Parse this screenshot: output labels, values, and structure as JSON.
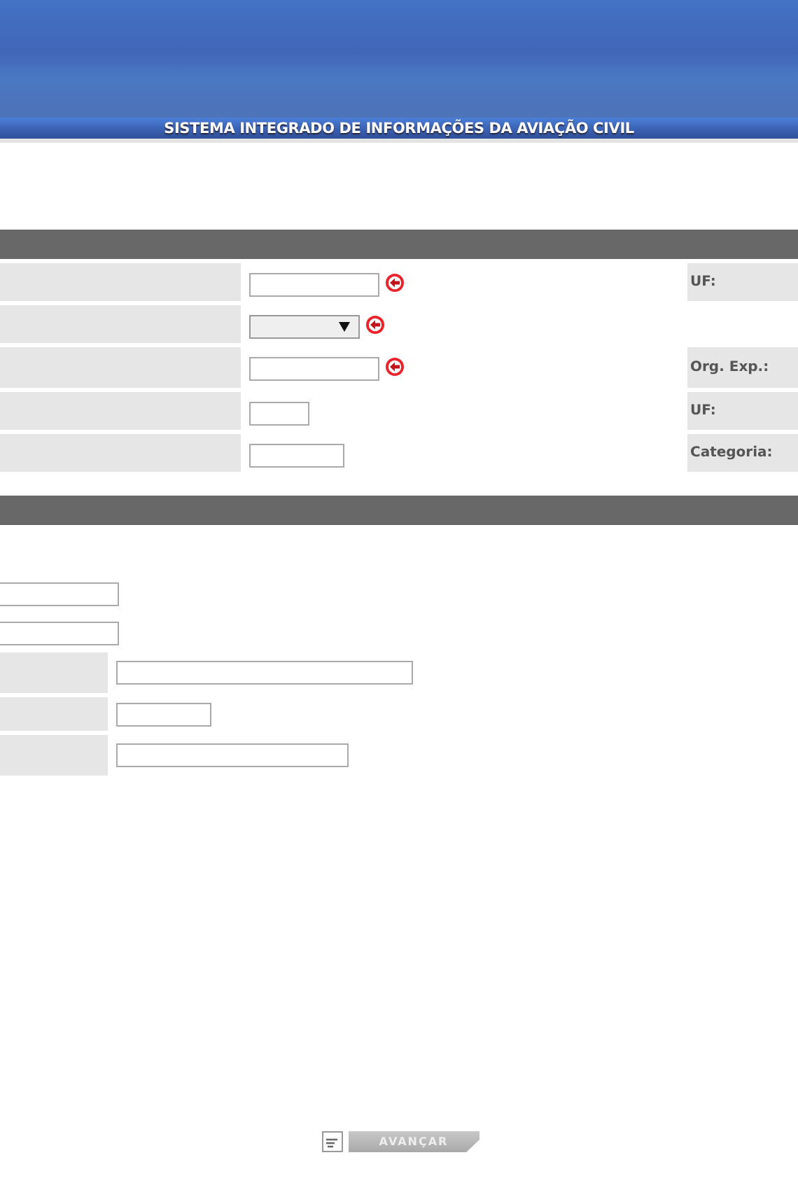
{
  "header": {
    "title": "SISTEMA INTEGRADO DE INFORMAÇÕES DA AVIAÇÃO CIVIL"
  },
  "section_1": {
    "rows": [
      {
        "field": {
          "kind": "text"
        },
        "required": true,
        "right_label": "UF:"
      },
      {
        "field": {
          "kind": "select"
        },
        "required": true
      },
      {
        "field": {
          "kind": "text"
        },
        "required": true,
        "right_label": "Org. Exp.:"
      },
      {
        "field": {
          "kind": "text"
        },
        "required": false,
        "right_label": "UF:"
      },
      {
        "field": {
          "kind": "text"
        },
        "required": false,
        "right_label": "Categoria:"
      }
    ]
  },
  "section_2": {
    "loose_fields": [
      {
        "kind": "text"
      },
      {
        "kind": "text"
      }
    ],
    "rows": [
      {
        "field": {
          "kind": "text"
        }
      },
      {
        "field": {
          "kind": "text"
        }
      },
      {
        "field": {
          "kind": "text"
        }
      }
    ]
  },
  "footer": {
    "button": "AVANÇAR"
  }
}
